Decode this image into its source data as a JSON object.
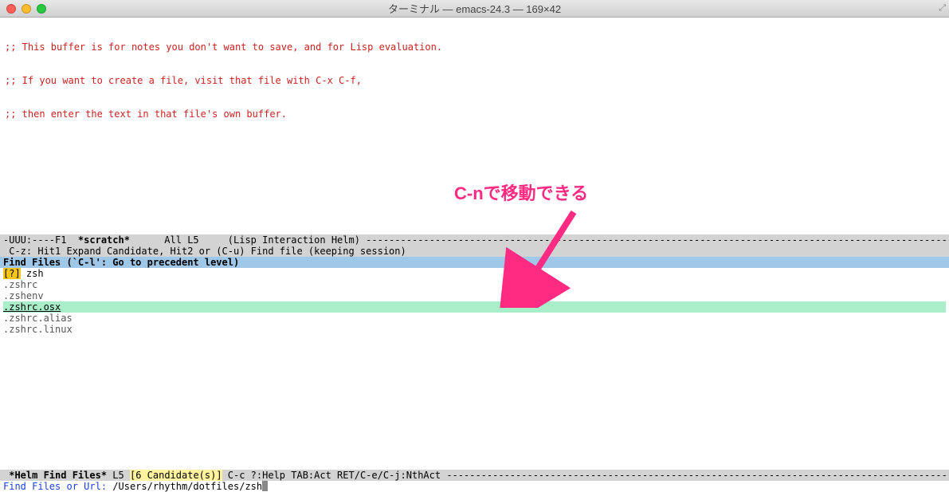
{
  "titlebar": {
    "title": "ターミナル — emacs-24.3 — 169×42"
  },
  "scratch": {
    "line1": ";; This buffer is for notes you don't want to save, and for Lisp evaluation.",
    "line2": ";; If you want to create a file, visit that file with C-x C-f,",
    "line3": ";; then enter the text in that file's own buffer."
  },
  "modeline1": {
    "left": "-UUU:----F1  ",
    "buf": "*scratch*",
    "mid": "      All L5     (Lisp Interaction Helm) "
  },
  "hint": " C-z: Hit1 Expand Candidate, Hit2 or (C-u) Find file (keeping session)",
  "helm": {
    "header": "Find Files (`C-l': Go to precedent level)",
    "mark": "[?]",
    "query": " zsh",
    "items": [
      {
        "text": ".zshrc",
        "sel": false
      },
      {
        "text": ".zshenv",
        "sel": false
      },
      {
        "text": ".zshrc.osx",
        "sel": true
      },
      {
        "text": ".zshrc.alias",
        "sel": false
      },
      {
        "text": ".zshrc.linux",
        "sel": false
      }
    ]
  },
  "modeline2": {
    "pre": " ",
    "buf": "*Helm Find Files*",
    "pos": " L5 ",
    "count": "[6 Candidate(s)]",
    "post": " C-c ?:Help TAB:Act RET/C-e/C-j:NthAct "
  },
  "minibuf": {
    "prompt": "Find Files or Url: ",
    "path": "/Users/rhythm/dotfiles/zsh"
  },
  "annotation": {
    "text": "C-nで移動できる"
  },
  "colors": {
    "accent": "#ff2a82",
    "helm_header_bg": "#9fc7e8",
    "helm_sel_bg": "#a8eec8"
  }
}
